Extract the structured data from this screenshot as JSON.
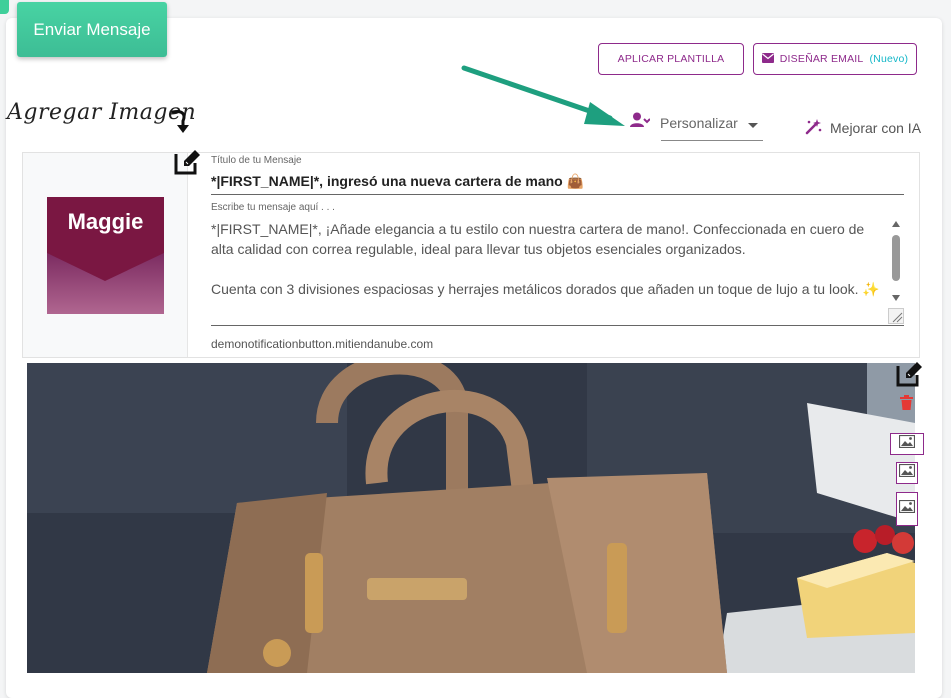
{
  "header": {
    "send_label": "Enviar Mensaje",
    "apply_template_label": "APLICAR PLANTILLA",
    "design_email_label": "DISEÑAR EMAIL",
    "design_email_badge": "(Nuevo)"
  },
  "annotation": {
    "add_image_label": "Agregar Imagen"
  },
  "toolbar": {
    "personalize_label": "Personalizar",
    "improve_ai_label": "Mejorar con IA"
  },
  "message": {
    "title_label": "Título de tu Mensaje",
    "title_value": "*|FIRST_NAME|*, ingresó una nueva cartera de mano 👜",
    "body_label": "Escribe tu mensaje aquí . . .",
    "body_paragraph_1": "*|FIRST_NAME|*, ¡Añade elegancia a tu estilo con nuestra cartera de mano!. Confeccionada en cuero de alta calidad con correa regulable, ideal para llevar tus objetos esenciales organizados.",
    "body_paragraph_2": "Cuenta con 3 divisiones espaciosas y herrajes metálicos dorados que añaden un toque de lujo a tu look. ✨",
    "url": "demonotificationbutton.mitiendanube.com"
  },
  "thumbnail": {
    "brand_text": "Maggie"
  },
  "colors": {
    "accent": "#8e2a8b",
    "send_button": "#44c99d",
    "teal_arrow": "#1e9f7f",
    "badge": "#14b7c8",
    "delete": "#e53935"
  },
  "icons": [
    "pencil-edit-icon",
    "user-icon",
    "magic-wand-icon",
    "envelope-icon",
    "trash-icon",
    "image-icon"
  ]
}
